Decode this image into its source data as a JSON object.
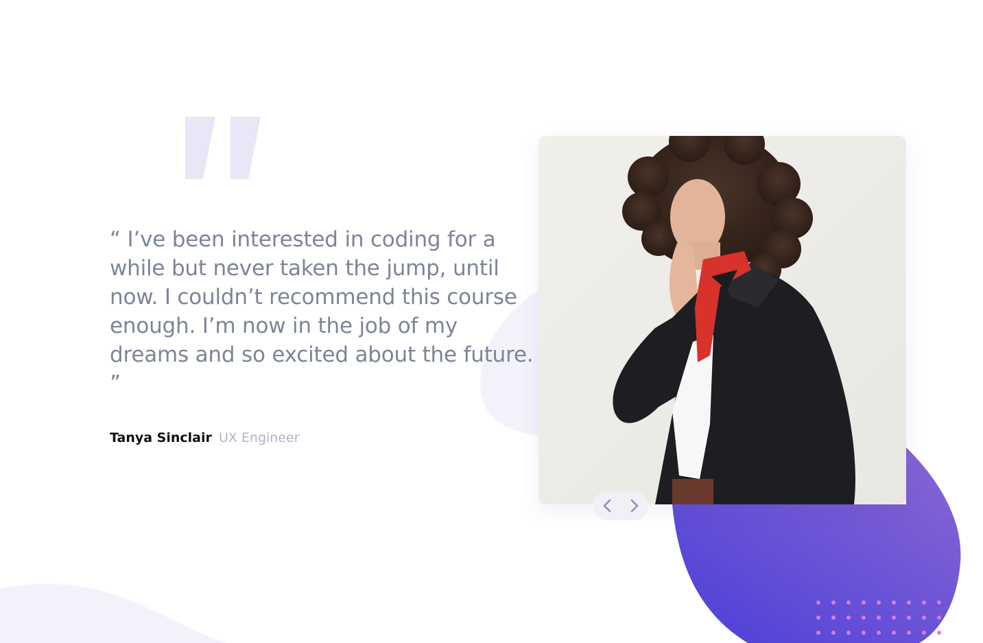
{
  "testimonial": {
    "quote": "“ I’ve been interested in coding for a while but never taken the jump, until now. I couldn’t recommend this course enough. I’m now in the job of my dreams and so excited about the future. ”",
    "author_name": "Tanya Sinclair",
    "author_role": "UX Engineer"
  },
  "photo": {
    "alt": "Tanya Sinclair portrait",
    "subject": "woman with curly hair wearing black coat and red scarf"
  },
  "icons": {
    "quote_mark": "quote-icon",
    "previous": "chevron-left-icon",
    "next": "chevron-right-icon"
  },
  "colors": {
    "quote_mark": "#e8e6f7",
    "quote_text": "#7c8497",
    "author_name": "#111111",
    "author_role": "#b3b1cb",
    "gradient_start": "#4b3fd8",
    "gradient_end": "#8a67d4",
    "dots": "#d77de0",
    "nav_bg": "#f0f0f6",
    "nav_icon": "#8a8fb8"
  }
}
